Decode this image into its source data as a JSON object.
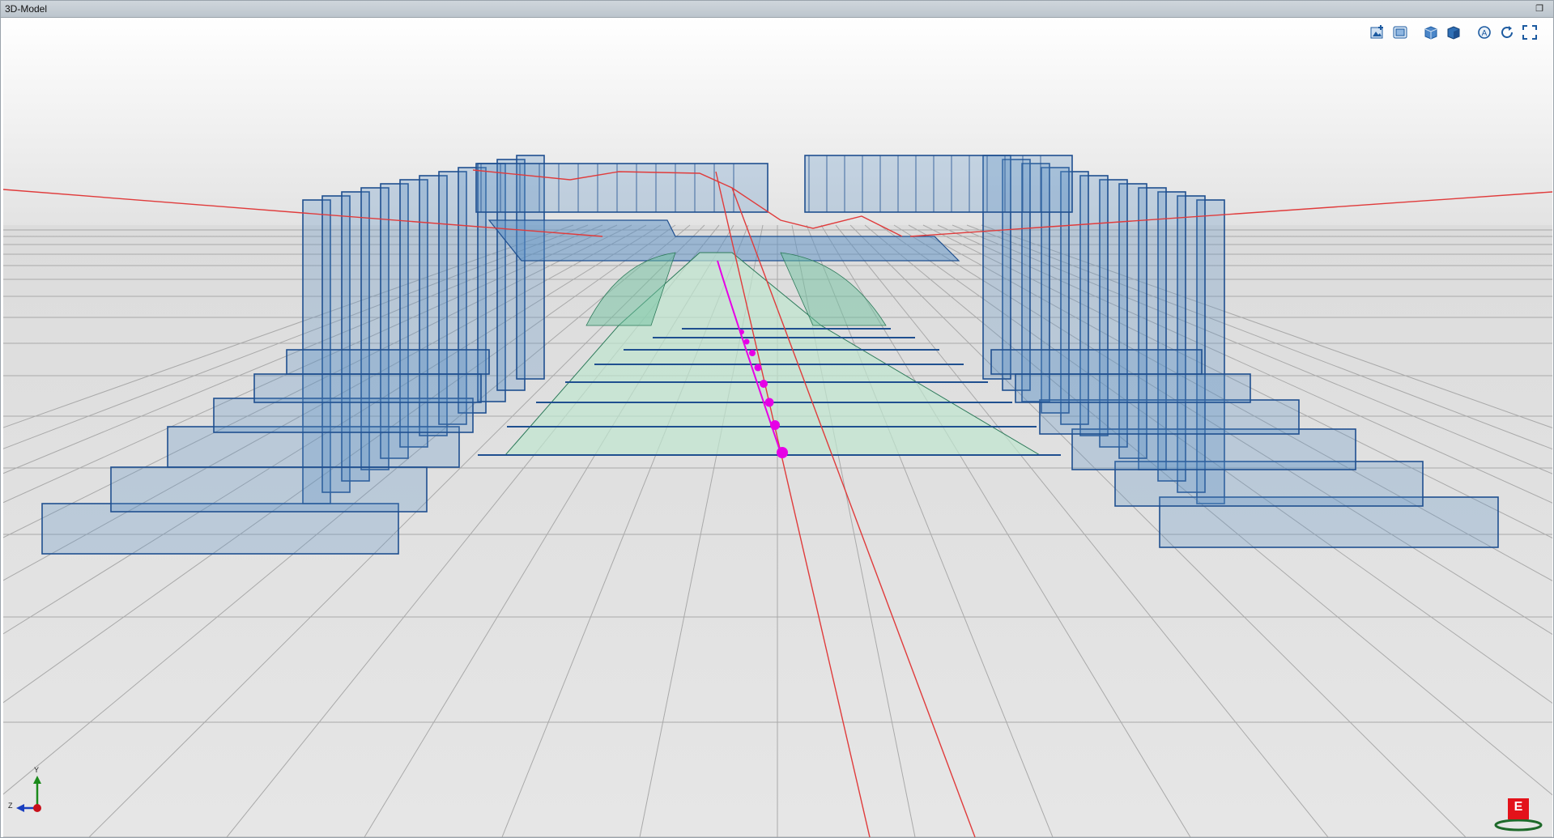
{
  "window": {
    "title": "3D-Model"
  },
  "toolbar": {
    "buttons": [
      {
        "name": "add-view-icon"
      },
      {
        "name": "view-frame-icon"
      },
      {
        "name": "solid-box-icon"
      },
      {
        "name": "shaded-box-icon"
      },
      {
        "name": "auto-rotate-icon"
      },
      {
        "name": "refresh-icon"
      },
      {
        "name": "fullscreen-icon"
      }
    ]
  },
  "axis": {
    "y_label": "Y",
    "z_label": "Z"
  },
  "badge": {
    "letter": "E"
  },
  "colors": {
    "structure_fill": "#5a8fc6",
    "structure_stroke": "#1f4f8f",
    "alignment": "#e03b3b",
    "stations": "#e600e6",
    "road_surface": "#bfe6cf",
    "grid": "#a9a9a9",
    "badge": "#e3121a"
  }
}
